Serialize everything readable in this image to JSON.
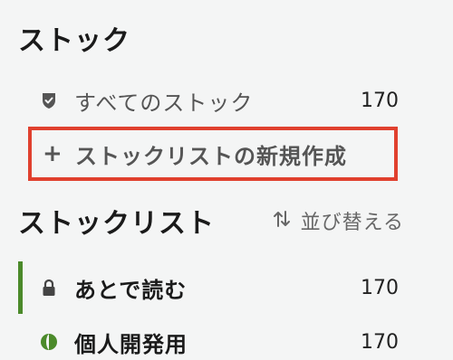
{
  "stock_section": {
    "title": "ストック",
    "all_stocks": {
      "label": "すべてのストック",
      "count": "170",
      "icon": "shield-check-icon"
    },
    "create_list": {
      "label": "ストックリストの新規作成",
      "icon": "plus-icon"
    }
  },
  "stocklist_section": {
    "title": "ストックリスト",
    "sort_label": "並び替える",
    "sort_icon": "sort-arrows-icon",
    "lists": [
      {
        "label": "あとで読む",
        "count": "170",
        "icon": "lock-icon",
        "active": true
      },
      {
        "label": "個人開発用",
        "count": "170",
        "icon": "globe-icon",
        "active": false
      }
    ]
  },
  "colors": {
    "accent_green": "#4b8a2a",
    "highlight_red": "#e0402e",
    "background": "#f4f5f5"
  }
}
